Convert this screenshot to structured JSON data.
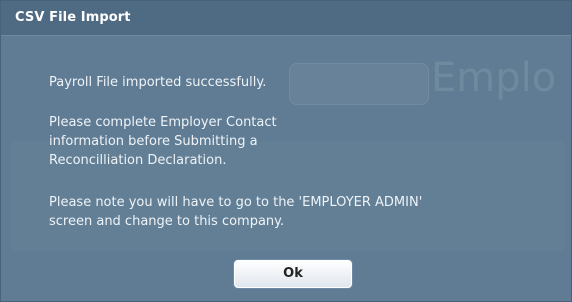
{
  "dialog": {
    "title": "CSV File Import",
    "messages": [
      "Payroll File imported successfully.",
      "Please complete Employer Contact\ninformation before Submitting a\nReconcilliation Declaration.",
      "Please note you will have to go to the 'EMPLOYER ADMIN'\nscreen and change to this company."
    ],
    "ok_label": "Ok"
  },
  "colors": {
    "dialog_bg": "#5f7c94",
    "titlebar_bg": "#4f6b83",
    "text": "#eef3f7",
    "button_border": "#6c8aa8"
  }
}
